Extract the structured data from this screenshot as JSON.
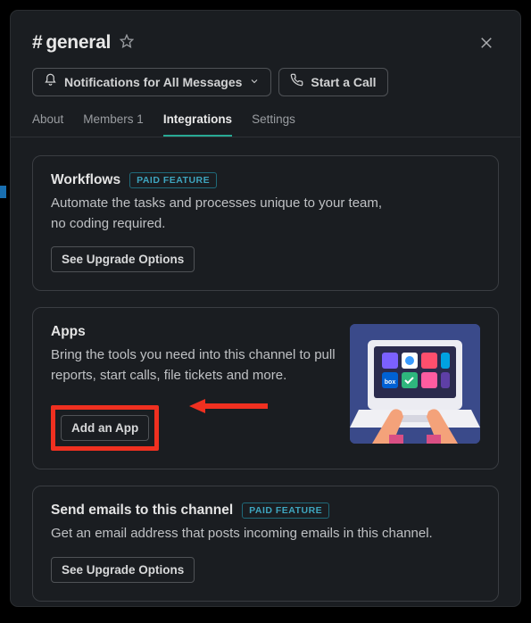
{
  "header": {
    "channel_name": "general",
    "notifications_label": "Notifications for All Messages",
    "start_call_label": "Start a Call"
  },
  "tabs": {
    "about": "About",
    "members": "Members 1",
    "integrations": "Integrations",
    "settings": "Settings"
  },
  "cards": {
    "workflows": {
      "title": "Workflows",
      "badge": "PAID FEATURE",
      "desc": "Automate the tasks and processes unique to your team, no coding required.",
      "btn": "See Upgrade Options"
    },
    "apps": {
      "title": "Apps",
      "desc": "Bring the tools you need into this channel to pull reports, start calls, file tickets and more.",
      "btn": "Add an App"
    },
    "emails": {
      "title": "Send emails to this channel",
      "badge": "PAID FEATURE",
      "desc": "Get an email address that posts incoming emails in this channel.",
      "btn": "See Upgrade Options"
    }
  }
}
